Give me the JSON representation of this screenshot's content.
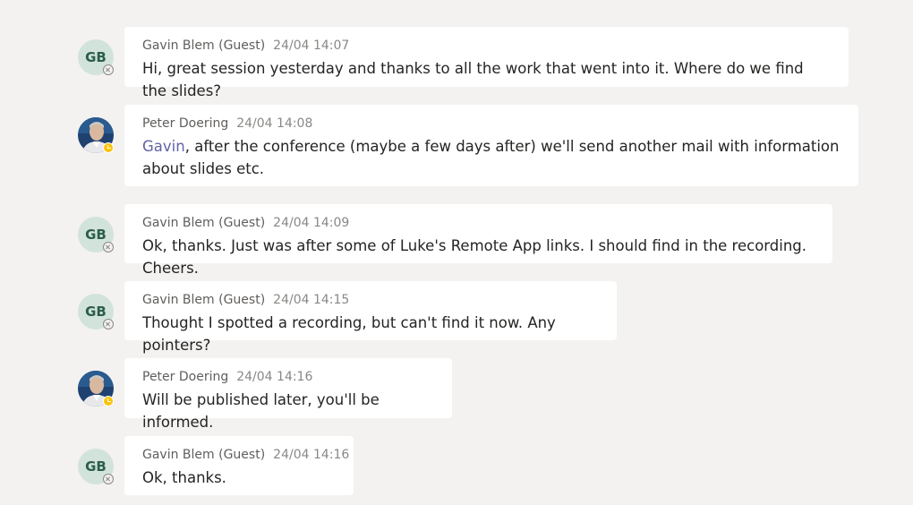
{
  "messages": [
    {
      "author": "Gavin Blem (Guest)",
      "time": "24/04 14:07",
      "initials": "GB",
      "text": "Hi, great session yesterday and thanks to all the work that went into it. Where do we find the slides?"
    },
    {
      "author": "Peter Doering",
      "time": "24/04 14:08",
      "mention": "Gavin",
      "text": ", after the conference (maybe a few days after) we'll send another mail with information about slides etc."
    },
    {
      "author": "Gavin Blem (Guest)",
      "time": "24/04 14:09",
      "initials": "GB",
      "text": "Ok, thanks. Just was after some of Luke's Remote App links. I should find in the recording. Cheers."
    },
    {
      "author": "Gavin Blem (Guest)",
      "time": "24/04 14:15",
      "initials": "GB",
      "text": "Thought I spotted a recording, but can't find it now. Any pointers?"
    },
    {
      "author": "Peter Doering",
      "time": "24/04 14:16",
      "text": "Will be published later, you'll be informed."
    },
    {
      "author": "Gavin Blem (Guest)",
      "time": "24/04 14:16",
      "initials": "GB",
      "text": "Ok, thanks."
    }
  ]
}
